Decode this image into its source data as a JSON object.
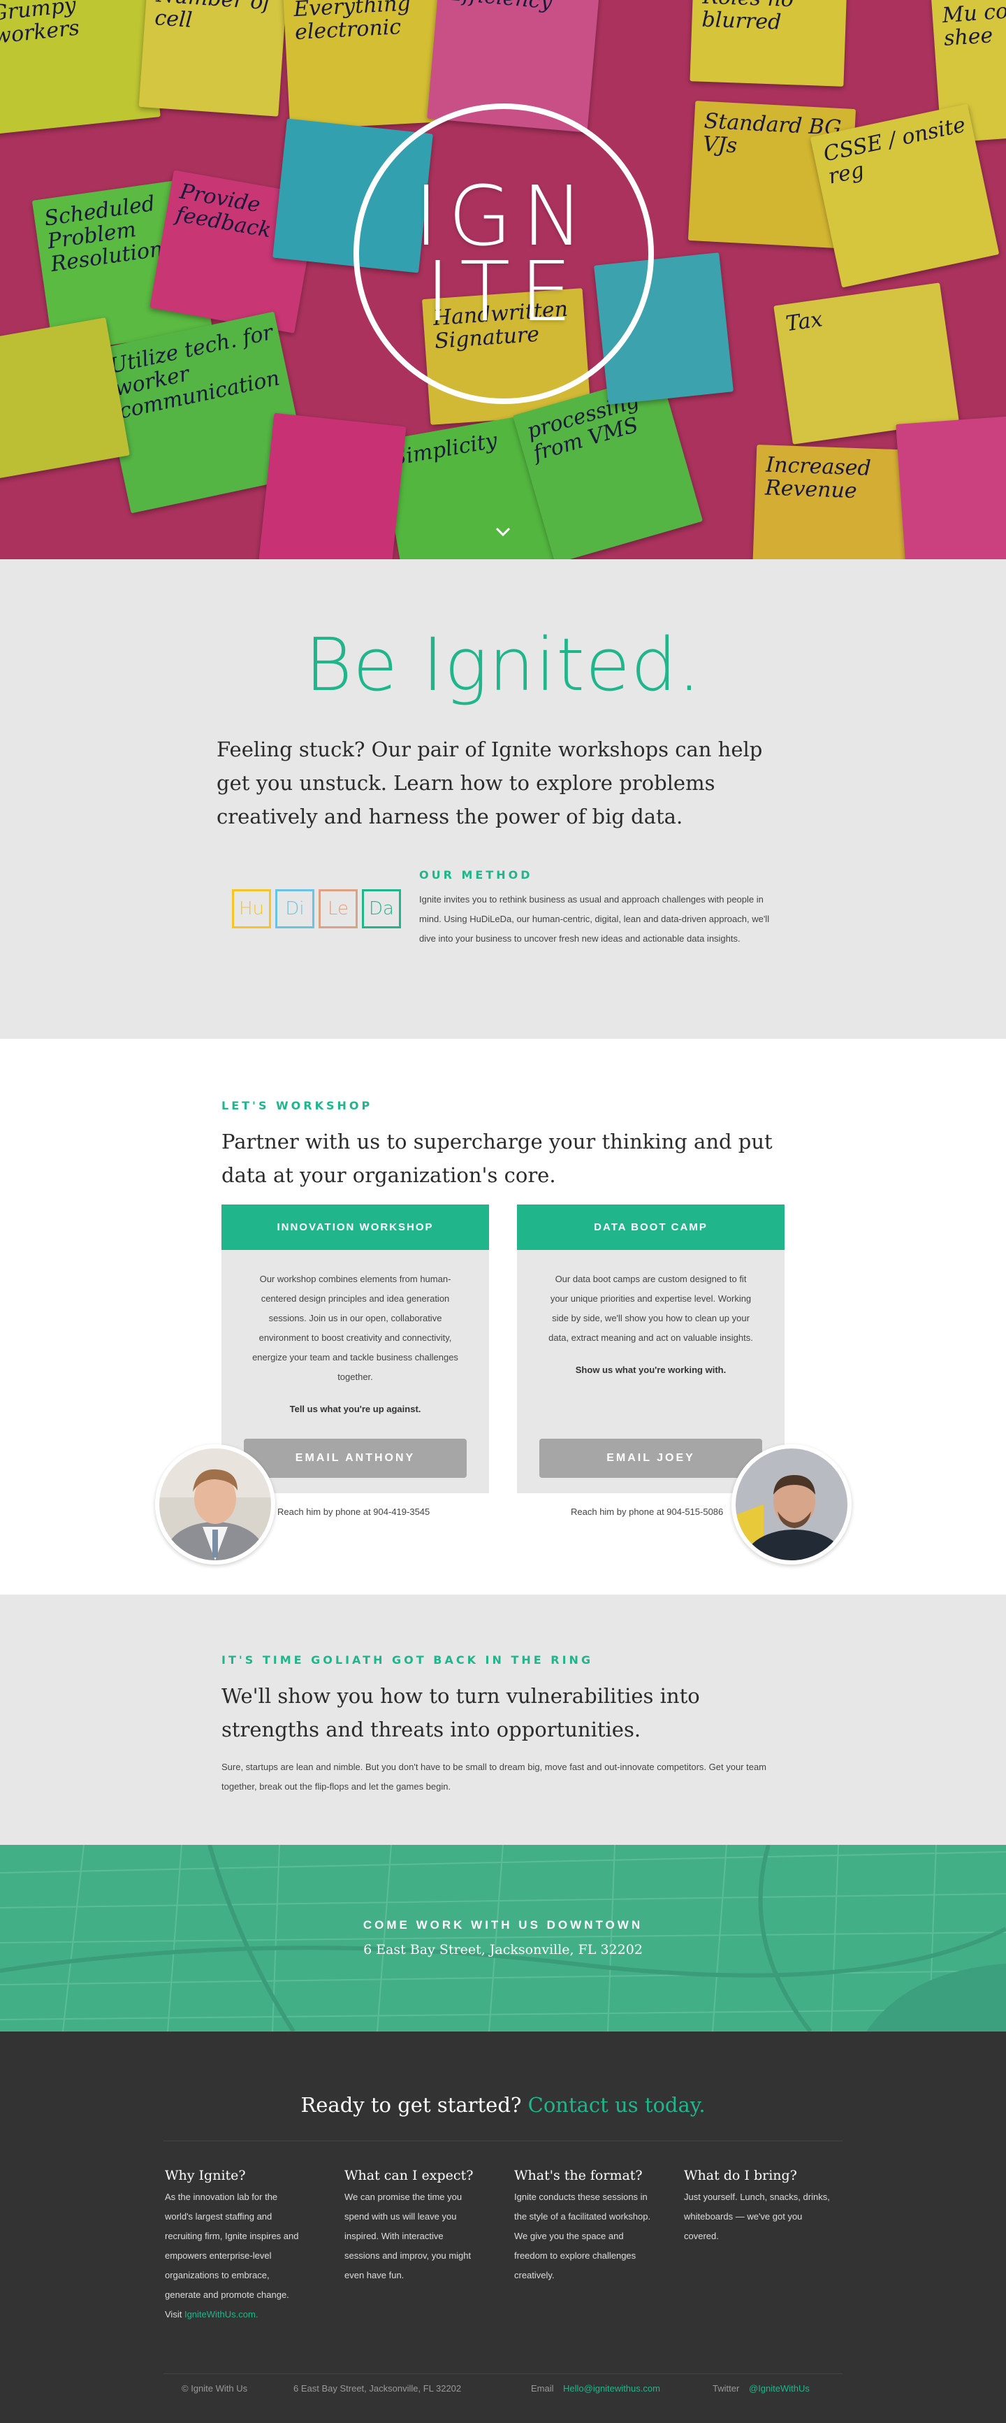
{
  "hero": {
    "logo_line1": "IGN",
    "logo_line2": "ITE",
    "notes": [
      {
        "text": "Grumpy workers",
        "color": "#d9e23a"
      },
      {
        "text": "Number of cell",
        "color": "#f2e24b"
      },
      {
        "text": "Everything electronic",
        "color": "#f2da3c"
      },
      {
        "text": "Efficiency",
        "color": "#e55a9a"
      },
      {
        "text": "Roles no blurred",
        "color": "#f4e142"
      },
      {
        "text": "Mu colo shee",
        "color": "#f4e247"
      },
      {
        "text": "Scheduled Problem Resolution",
        "color": "#67d44b"
      },
      {
        "text": "Provide feedback",
        "color": "#e43f84"
      },
      {
        "text": "Standard BG VJs",
        "color": "#f0cf38"
      },
      {
        "text": "CSSE / onsite reg",
        "color": "#f4e247"
      },
      {
        "text": "Utilize tech. for worker communication",
        "color": "#61cf4e"
      },
      {
        "text": "Handwritten Signature",
        "color": "#f0d33d"
      },
      {
        "text": "Tax",
        "color": "#f2e04a"
      },
      {
        "text": "Simplicity",
        "color": "#5fd048"
      },
      {
        "text": "processing from VMS",
        "color": "#61cf4e"
      },
      {
        "text": "Increased Revenue",
        "color": "#f2c63c"
      }
    ]
  },
  "intro": {
    "title": "Be Ignited.",
    "lead": "Feeling stuck? Our pair of Ignite workshops can help get you unstuck.  Learn how to explore problems creatively and harness the power of big data.",
    "method_eyebrow": "OUR METHOD",
    "method_text": "Ignite invites you to rethink business as usual and approach challenges with people in mind. Using HuDiLeDa, our human-centric, digital, lean and data-driven approach, we'll dive into your business to uncover fresh new ideas and actionable data insights.",
    "tiles": [
      {
        "label": "Hu",
        "color": "#f5c426"
      },
      {
        "label": "Di",
        "color": "#6bc3e3"
      },
      {
        "label": "Le",
        "color": "#dfa184"
      },
      {
        "label": "Da",
        "color": "#21b58c"
      }
    ]
  },
  "workshop": {
    "eyebrow": "LET'S WORKSHOP",
    "lead": "Partner with us to supercharge your thinking and put data at your organization's core.",
    "cards": [
      {
        "title": "INNOVATION WORKSHOP",
        "body": "Our workshop combines elements from human-centered design principles and idea generation sessions.  Join us in our open, collaborative environment to boost creativity and connectivity, energize your team and tackle business challenges together.",
        "cta": "Tell us what you're up against.",
        "button": "EMAIL ANTHONY",
        "phone": "Reach him by phone at 904-419-3545"
      },
      {
        "title": "DATA BOOT CAMP",
        "body": "Our data boot camps are custom designed to fit your unique priorities and expertise level. Working side by side, we'll show you how to clean up your data, extract meaning and act on valuable insights.",
        "cta": "Show us what you're working with.",
        "button": "EMAIL JOEY",
        "phone": "Reach him by phone at 904-515-5086"
      }
    ]
  },
  "goliath": {
    "eyebrow": "IT'S TIME GOLIATH GOT BACK IN THE RING",
    "lead": "We'll show you how to turn vulnerabilities into strengths and threats into opportunities.",
    "text": "Sure, startups are lean and nimble. But you don't have to be small to dream big, move fast and out-innovate competitors. Get your team together, break out the flip-flops and let the games begin."
  },
  "map": {
    "eyebrow": "COME WORK WITH US DOWNTOWN",
    "address": "6 East Bay Street, Jacksonville, FL 32202"
  },
  "footer": {
    "ready_text": "Ready to get started?",
    "ready_link": "Contact us today.",
    "columns": [
      {
        "title": "Why Ignite?",
        "text": "As the innovation lab for the world's largest staffing and recruiting firm, Ignite inspires and empowers enterprise-level organizations to embrace, generate and promote change.",
        "visit": "Visit",
        "link": "IgniteWithUs.com."
      },
      {
        "title": "What can I expect?",
        "text": "We can promise the time you spend with us will leave you inspired. With interactive sessions and improv, you might even have fun."
      },
      {
        "title": "What's the format?",
        "text": "Ignite conducts these sessions in the style of a facilitated workshop. We give you the space and freedom to explore challenges creatively."
      },
      {
        "title": "What do I bring?",
        "text": "Just yourself. Lunch, snacks, drinks, whiteboards — we've got you covered."
      }
    ],
    "copyright": "© Ignite With Us",
    "address": "6 East Bay Street, Jacksonville, FL 32202",
    "email_label": "Email",
    "email": "Hello@ignitewithus.com",
    "twitter_label": "Twitter",
    "twitter": "@IgniteWithUs"
  }
}
